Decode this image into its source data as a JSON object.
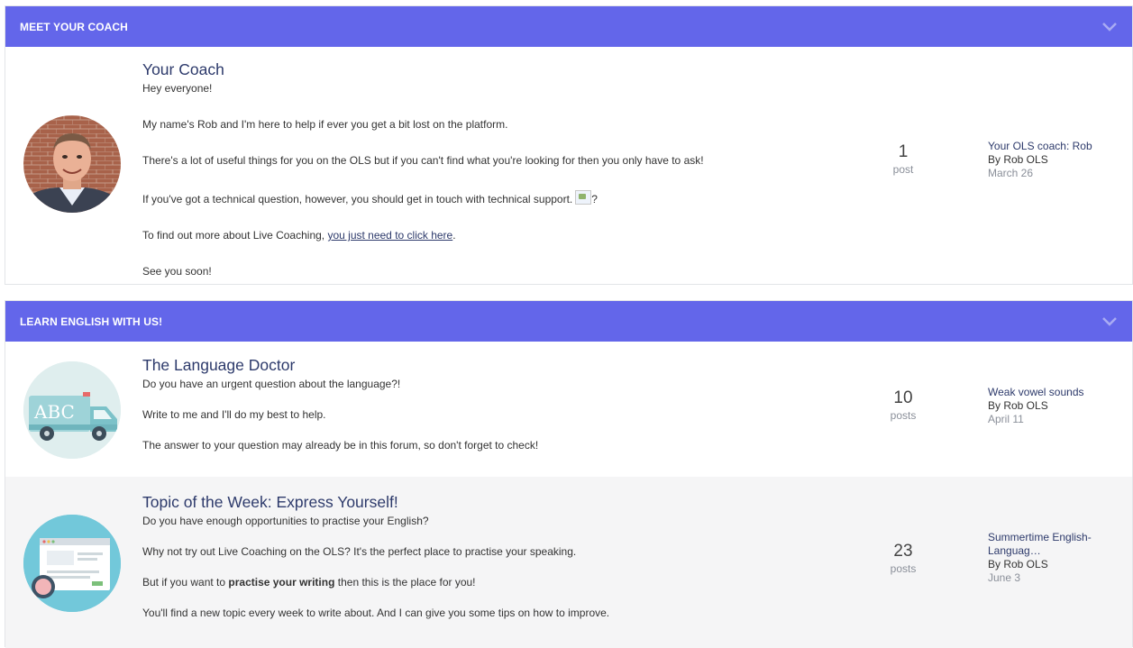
{
  "sections": [
    {
      "header": "MEET YOUR COACH",
      "forums": [
        {
          "title": "Your Coach",
          "description": [
            "Hey everyone!",
            "My name's Rob and I'm here to help if ever you get a bit lost on the platform.",
            "There's a lot of useful things for you on the OLS but if you can't find what you're looking for then you only have to ask!",
            "If you've got a technical question, however, you should get in touch with technical support.",
            "To find out more about Live Coaching, ",
            "See you soon!"
          ],
          "broken_image_suffix": "?",
          "link_text": "you just need to click here",
          "link_after": ".",
          "count": "1",
          "count_label": "post",
          "last_title": "Your OLS coach: Rob",
          "last_by": "By Rob OLS",
          "last_date": "March 26"
        }
      ]
    },
    {
      "header": "LEARN ENGLISH WITH US!",
      "forums": [
        {
          "title": "The Language Doctor",
          "description": [
            "Do you have an urgent question about the language?!",
            "Write to me and I'll do my best to help.",
            "The answer to your question may already be in this forum, so don't forget to check!"
          ],
          "icon_text": "ABC",
          "count": "10",
          "count_label": "posts",
          "last_title": "Weak vowel sounds",
          "last_by": "By Rob OLS",
          "last_date": "April 11"
        },
        {
          "title": "Topic of the Week: Express Yourself!",
          "description": [
            "Do you have enough opportunities to practise your English?",
            "Why not try out Live Coaching on the OLS? It's the perfect place to practise your speaking.",
            "But if you want to ",
            "You'll find a new topic every week to write about. And I can give you some tips on how to improve."
          ],
          "bold_text": "practise your writing",
          "bold_after": " then this is the place for you!",
          "count": "23",
          "count_label": "posts",
          "last_title_line1": "Summertime English-",
          "last_title_line2": "Languag…",
          "last_by": "By Rob OLS",
          "last_date": "June 3"
        }
      ]
    }
  ],
  "colors": {
    "header_bg": "#6366ea",
    "title": "#2d3a6b",
    "alt_row": "#f5f5f6"
  }
}
